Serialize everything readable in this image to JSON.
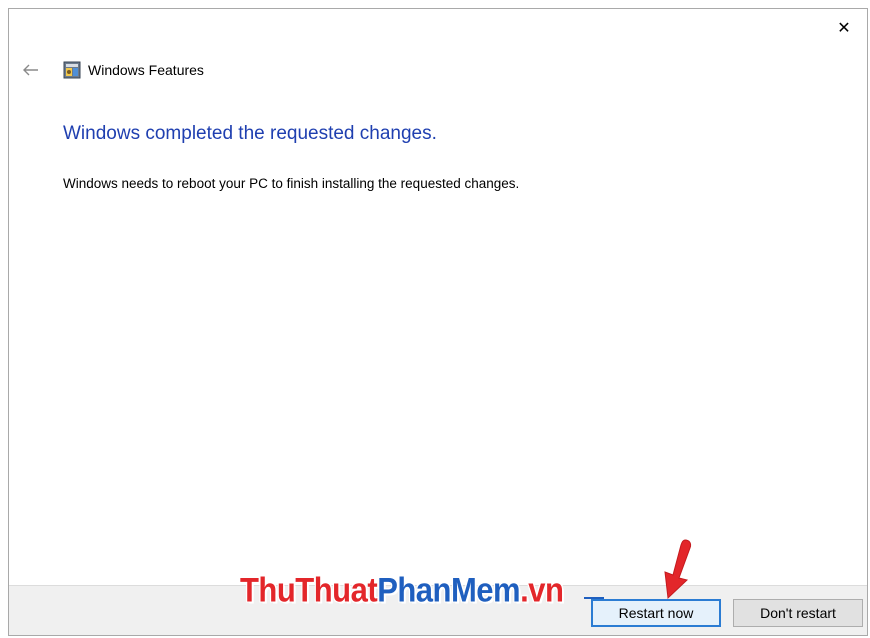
{
  "window": {
    "title": "Windows Features",
    "close_glyph": "✕"
  },
  "content": {
    "heading": "Windows completed the requested changes.",
    "message": "Windows needs to reboot your PC to finish installing the requested changes."
  },
  "footer": {
    "restart_label": "Restart now",
    "dont_restart_label": "Don't restart"
  },
  "watermark": {
    "part1": "ThuThuat",
    "part2": "PhanMem",
    "part3": ".vn"
  },
  "colors": {
    "heading": "#1f3fb0",
    "accent_focus": "#2b7cd3",
    "watermark_red": "#e3262a",
    "watermark_blue": "#1f5fbf"
  },
  "icons": {
    "back": "arrow-left-icon",
    "app": "windows-features-icon",
    "close": "close-icon",
    "pointer": "red-arrow-pointer-icon"
  }
}
